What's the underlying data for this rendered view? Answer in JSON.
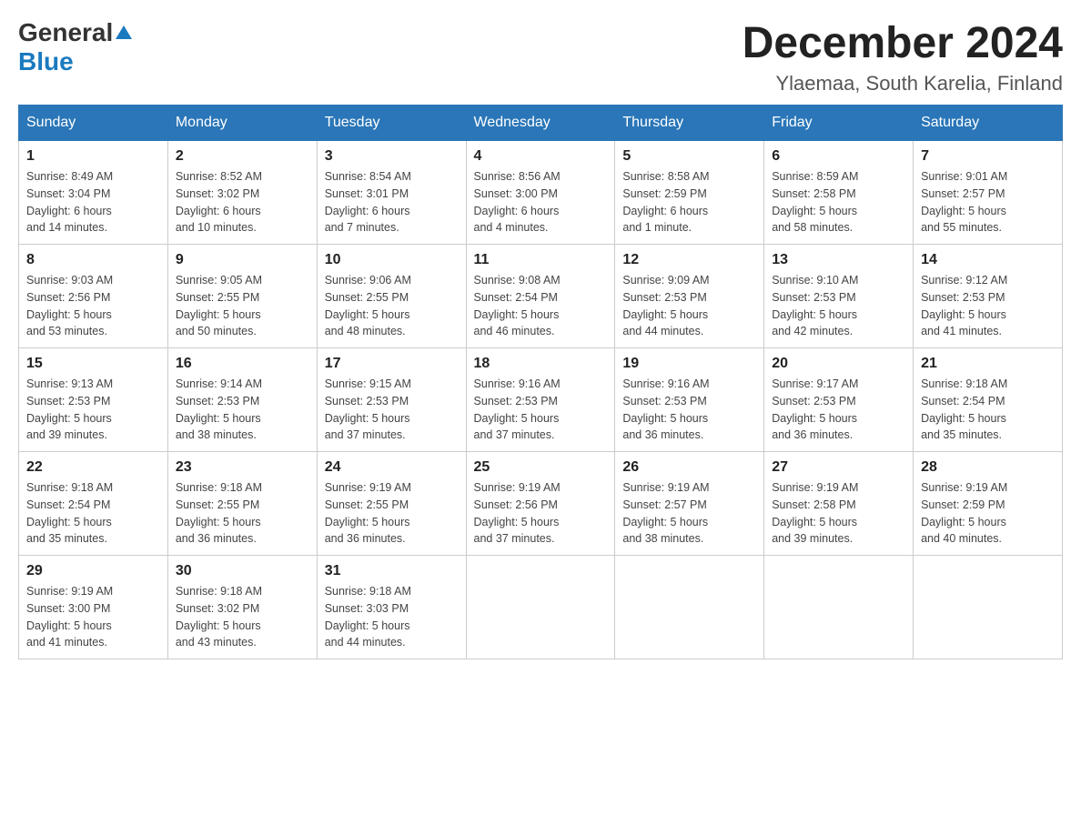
{
  "logo": {
    "general": "General",
    "triangle": "▶",
    "blue": "Blue"
  },
  "title": "December 2024",
  "subtitle": "Ylaemaa, South Karelia, Finland",
  "days_of_week": [
    "Sunday",
    "Monday",
    "Tuesday",
    "Wednesday",
    "Thursday",
    "Friday",
    "Saturday"
  ],
  "weeks": [
    [
      {
        "day": "1",
        "sunrise": "8:49 AM",
        "sunset": "3:04 PM",
        "daylight": "6 hours and 14 minutes."
      },
      {
        "day": "2",
        "sunrise": "8:52 AM",
        "sunset": "3:02 PM",
        "daylight": "6 hours and 10 minutes."
      },
      {
        "day": "3",
        "sunrise": "8:54 AM",
        "sunset": "3:01 PM",
        "daylight": "6 hours and 7 minutes."
      },
      {
        "day": "4",
        "sunrise": "8:56 AM",
        "sunset": "3:00 PM",
        "daylight": "6 hours and 4 minutes."
      },
      {
        "day": "5",
        "sunrise": "8:58 AM",
        "sunset": "2:59 PM",
        "daylight": "6 hours and 1 minute."
      },
      {
        "day": "6",
        "sunrise": "8:59 AM",
        "sunset": "2:58 PM",
        "daylight": "5 hours and 58 minutes."
      },
      {
        "day": "7",
        "sunrise": "9:01 AM",
        "sunset": "2:57 PM",
        "daylight": "5 hours and 55 minutes."
      }
    ],
    [
      {
        "day": "8",
        "sunrise": "9:03 AM",
        "sunset": "2:56 PM",
        "daylight": "5 hours and 53 minutes."
      },
      {
        "day": "9",
        "sunrise": "9:05 AM",
        "sunset": "2:55 PM",
        "daylight": "5 hours and 50 minutes."
      },
      {
        "day": "10",
        "sunrise": "9:06 AM",
        "sunset": "2:55 PM",
        "daylight": "5 hours and 48 minutes."
      },
      {
        "day": "11",
        "sunrise": "9:08 AM",
        "sunset": "2:54 PM",
        "daylight": "5 hours and 46 minutes."
      },
      {
        "day": "12",
        "sunrise": "9:09 AM",
        "sunset": "2:53 PM",
        "daylight": "5 hours and 44 minutes."
      },
      {
        "day": "13",
        "sunrise": "9:10 AM",
        "sunset": "2:53 PM",
        "daylight": "5 hours and 42 minutes."
      },
      {
        "day": "14",
        "sunrise": "9:12 AM",
        "sunset": "2:53 PM",
        "daylight": "5 hours and 41 minutes."
      }
    ],
    [
      {
        "day": "15",
        "sunrise": "9:13 AM",
        "sunset": "2:53 PM",
        "daylight": "5 hours and 39 minutes."
      },
      {
        "day": "16",
        "sunrise": "9:14 AM",
        "sunset": "2:53 PM",
        "daylight": "5 hours and 38 minutes."
      },
      {
        "day": "17",
        "sunrise": "9:15 AM",
        "sunset": "2:53 PM",
        "daylight": "5 hours and 37 minutes."
      },
      {
        "day": "18",
        "sunrise": "9:16 AM",
        "sunset": "2:53 PM",
        "daylight": "5 hours and 37 minutes."
      },
      {
        "day": "19",
        "sunrise": "9:16 AM",
        "sunset": "2:53 PM",
        "daylight": "5 hours and 36 minutes."
      },
      {
        "day": "20",
        "sunrise": "9:17 AM",
        "sunset": "2:53 PM",
        "daylight": "5 hours and 36 minutes."
      },
      {
        "day": "21",
        "sunrise": "9:18 AM",
        "sunset": "2:54 PM",
        "daylight": "5 hours and 35 minutes."
      }
    ],
    [
      {
        "day": "22",
        "sunrise": "9:18 AM",
        "sunset": "2:54 PM",
        "daylight": "5 hours and 35 minutes."
      },
      {
        "day": "23",
        "sunrise": "9:18 AM",
        "sunset": "2:55 PM",
        "daylight": "5 hours and 36 minutes."
      },
      {
        "day": "24",
        "sunrise": "9:19 AM",
        "sunset": "2:55 PM",
        "daylight": "5 hours and 36 minutes."
      },
      {
        "day": "25",
        "sunrise": "9:19 AM",
        "sunset": "2:56 PM",
        "daylight": "5 hours and 37 minutes."
      },
      {
        "day": "26",
        "sunrise": "9:19 AM",
        "sunset": "2:57 PM",
        "daylight": "5 hours and 38 minutes."
      },
      {
        "day": "27",
        "sunrise": "9:19 AM",
        "sunset": "2:58 PM",
        "daylight": "5 hours and 39 minutes."
      },
      {
        "day": "28",
        "sunrise": "9:19 AM",
        "sunset": "2:59 PM",
        "daylight": "5 hours and 40 minutes."
      }
    ],
    [
      {
        "day": "29",
        "sunrise": "9:19 AM",
        "sunset": "3:00 PM",
        "daylight": "5 hours and 41 minutes."
      },
      {
        "day": "30",
        "sunrise": "9:18 AM",
        "sunset": "3:02 PM",
        "daylight": "5 hours and 43 minutes."
      },
      {
        "day": "31",
        "sunrise": "9:18 AM",
        "sunset": "3:03 PM",
        "daylight": "5 hours and 44 minutes."
      },
      null,
      null,
      null,
      null
    ]
  ],
  "labels": {
    "sunrise": "Sunrise:",
    "sunset": "Sunset:",
    "daylight": "Daylight:"
  }
}
